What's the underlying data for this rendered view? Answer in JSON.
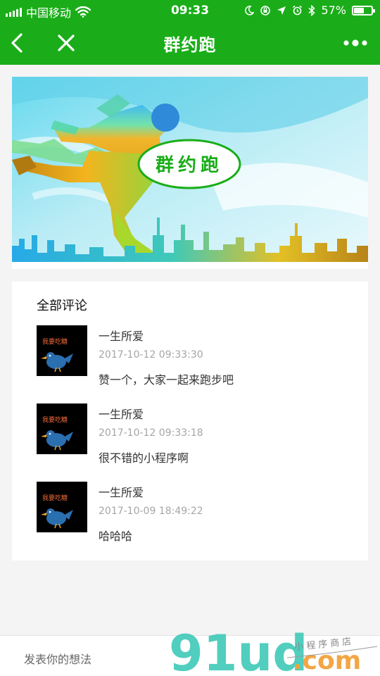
{
  "status": {
    "carrier": "中国移动",
    "time": "09:33",
    "battery": "57%",
    "battery_level": 0.57
  },
  "nav": {
    "title": "群约跑"
  },
  "banner": {
    "text": "群约跑"
  },
  "comments": {
    "heading": "全部评论",
    "items": [
      {
        "user": "一生所爱",
        "time": "2017-10-12 09:33:30",
        "text": "赞一个，大家一起来跑步吧"
      },
      {
        "user": "一生所爱",
        "time": "2017-10-12 09:33:18",
        "text": "很不错的小程序啊"
      },
      {
        "user": "一生所爱",
        "time": "2017-10-09 18:49:22",
        "text": "哈哈哈"
      }
    ]
  },
  "footer": {
    "placeholder": "发表你的想法"
  },
  "watermark": {
    "brand": "91ud",
    "domain": ".com",
    "tagline": "小程序商店"
  },
  "colors": {
    "brand_green": "#1aad19",
    "timestamp_gray": "#a6a6a6"
  }
}
